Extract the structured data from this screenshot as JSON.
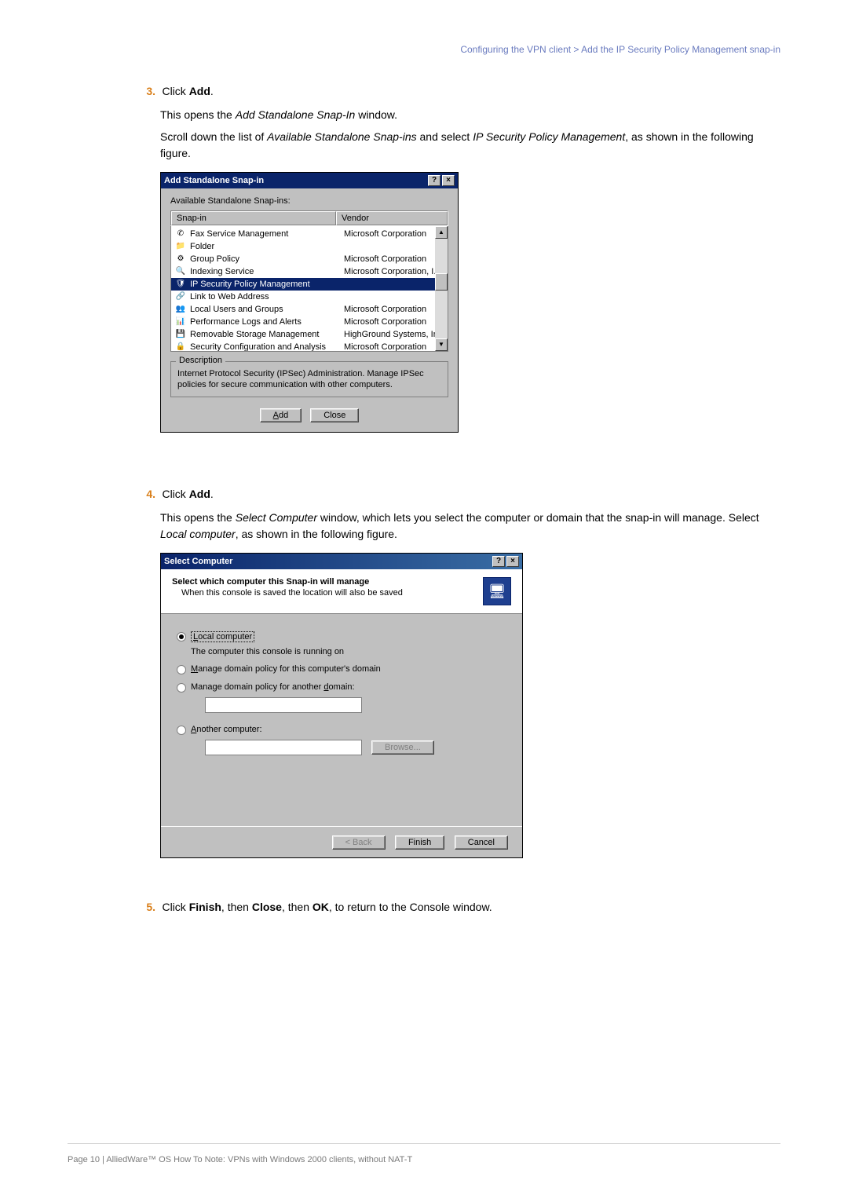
{
  "breadcrumb": "Configuring the VPN client  >  Add the IP Security Policy Management snap-in",
  "steps": {
    "s3": {
      "num": "3.",
      "text_prefix": "Click ",
      "text_bold": "Add",
      "text_suffix": "."
    },
    "s3_body1_a": "This opens the ",
    "s3_body1_i": "Add Standalone Snap-In",
    "s3_body1_b": " window.",
    "s3_body2_a": "Scroll down the list of ",
    "s3_body2_i1": "Available Standalone Snap-ins",
    "s3_body2_b": " and select ",
    "s3_body2_i2": "IP Security Policy Management",
    "s3_body2_c": ", as shown in the following figure.",
    "s4": {
      "num": "4.",
      "text_prefix": "Click ",
      "text_bold": "Add",
      "text_suffix": "."
    },
    "s4_body1_a": "This opens the ",
    "s4_body1_i": "Select Computer",
    "s4_body1_b": " window, which lets you select the computer or domain that the snap-in will manage. Select ",
    "s4_body1_i2": "Local computer",
    "s4_body1_c": ", as shown in the following figure.",
    "s5": {
      "num": "5.",
      "prefix": "Click ",
      "b1": "Finish",
      "mid1": ", then ",
      "b2": "Close",
      "mid2": ", then ",
      "b3": "OK",
      "suffix": ", to return to the Console window."
    }
  },
  "dlg1": {
    "title": "Add Standalone Snap-in",
    "avail": "Available Standalone Snap-ins:",
    "col_snap": "Snap-in",
    "col_vendor": "Vendor",
    "rows": [
      {
        "name": "Fax Service Management",
        "vendor": "Microsoft Corporation"
      },
      {
        "name": "Folder",
        "vendor": ""
      },
      {
        "name": "Group Policy",
        "vendor": "Microsoft Corporation"
      },
      {
        "name": "Indexing Service",
        "vendor": "Microsoft Corporation, I..."
      },
      {
        "name": "IP Security Policy Management",
        "vendor": ""
      },
      {
        "name": "Link to Web Address",
        "vendor": ""
      },
      {
        "name": "Local Users and Groups",
        "vendor": "Microsoft Corporation"
      },
      {
        "name": "Performance Logs and Alerts",
        "vendor": "Microsoft Corporation"
      },
      {
        "name": "Removable Storage Management",
        "vendor": "HighGround Systems, Inc."
      },
      {
        "name": "Security Configuration and Analysis",
        "vendor": "Microsoft Corporation"
      }
    ],
    "desc_legend": "Description",
    "desc_text": "Internet Protocol Security (IPSec) Administration. Manage IPSec policies for secure communication with other computers.",
    "btn_add": "Add",
    "btn_close": "Close"
  },
  "dlg2": {
    "title": "Select Computer",
    "top1": "Select which computer this Snap-in will manage",
    "top2": "When this console is saved the location will also be saved",
    "r1_prefix": "L",
    "r1_rest": "ocal computer",
    "r1_sub": "The computer this console is running on",
    "r2_prefix": "M",
    "r2_rest": "anage domain policy for this computer's domain",
    "r3_text": "Manage domain policy for another ",
    "r3_u": "d",
    "r3_rest": "omain:",
    "r4_prefix": "A",
    "r4_rest": "nother computer:",
    "btn_browse": "Browse...",
    "btn_back": "< Back",
    "btn_finish": "Finish",
    "btn_cancel": "Cancel"
  },
  "footer": "Page 10 | AlliedWare™ OS How To Note: VPNs with Windows 2000 clients, without NAT-T"
}
